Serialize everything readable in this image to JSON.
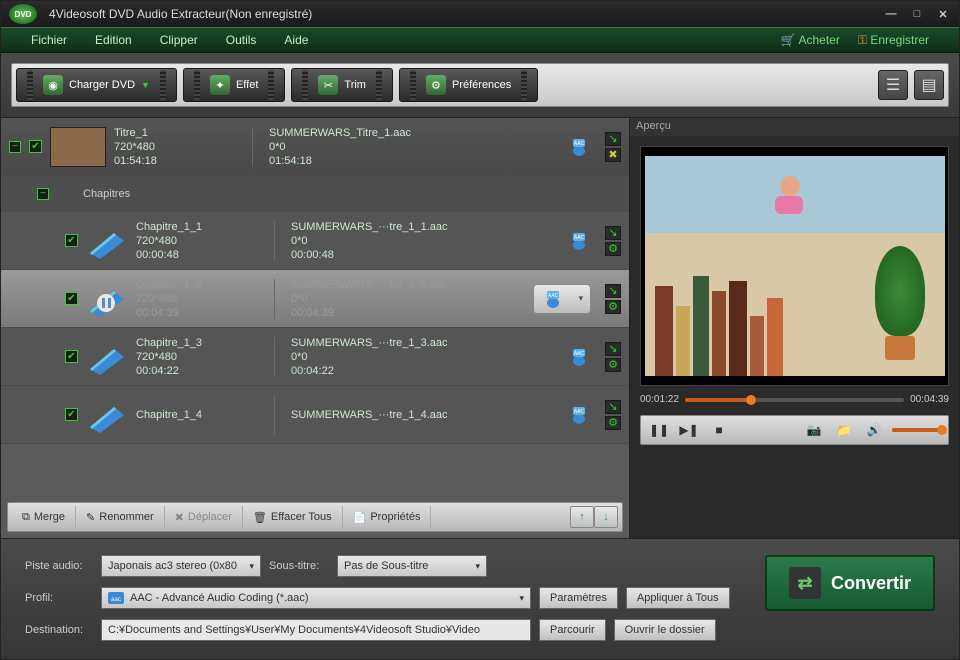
{
  "title": "4Videosoft DVD Audio Extracteur(Non enregistré)",
  "logo_text": "DVD",
  "menubar": {
    "items": [
      "Fichier",
      "Edition",
      "Clipper",
      "Outils",
      "Aide"
    ],
    "buy": "Acheter",
    "register": "Enregistrer"
  },
  "toolbar": {
    "load_dvd": "Charger DVD",
    "effect": "Effet",
    "trim": "Trim",
    "prefs": "Préférences"
  },
  "list": {
    "title_row": {
      "name": "Titre_1",
      "res": "720*480",
      "dur": "01:54:18",
      "out": "SUMMERWARS_Titre_1.aac",
      "outres": "0*0",
      "outdur": "01:54:18"
    },
    "chapters_label": "Chapitres",
    "chapters": [
      {
        "name": "Chapitre_1_1",
        "res": "720*480",
        "dur": "00:00:48",
        "out": "SUMMERWARS_···tre_1_1.aac",
        "outres": "0*0",
        "outdur": "00:00:48",
        "selected": false
      },
      {
        "name": "Chapitre_1_2",
        "res": "720*480",
        "dur": "00:04:39",
        "out": "SUMMERWARS_···tre_1_2.aac",
        "outres": "0*0",
        "outdur": "00:04:39",
        "selected": true
      },
      {
        "name": "Chapitre_1_3",
        "res": "720*480",
        "dur": "00:04:22",
        "out": "SUMMERWARS_···tre_1_3.aac",
        "outres": "0*0",
        "outdur": "00:04:22",
        "selected": false
      },
      {
        "name": "Chapitre_1_4",
        "res": "",
        "dur": "",
        "out": "SUMMERWARS_···tre_1_4.aac",
        "outres": "",
        "outdur": "",
        "selected": false
      }
    ]
  },
  "actions": {
    "merge": "Merge",
    "rename": "Renommer",
    "move": "Déplacer",
    "clear": "Effacer Tous",
    "props": "Propriétés"
  },
  "preview": {
    "label": "Aperçu",
    "current": "00:01:22",
    "total": "00:04:39"
  },
  "bottom": {
    "audio_label": "Piste audio:",
    "audio_value": "Japonais ac3 stereo (0x80",
    "subtitle_label": "Sous-titre:",
    "subtitle_value": "Pas de Sous-titre",
    "profile_label": "Profil:",
    "profile_value": "AAC - Advancé Audio Coding (*.aac)",
    "settings": "Paramètres",
    "apply_all": "Appliquer à Tous",
    "dest_label": "Destination:",
    "dest_value": "C:¥Documents and Settings¥User¥My Documents¥4Videosoft Studio¥Video",
    "browse": "Parcourir",
    "open_folder": "Ouvrir le dossier",
    "convert": "Convertir"
  }
}
